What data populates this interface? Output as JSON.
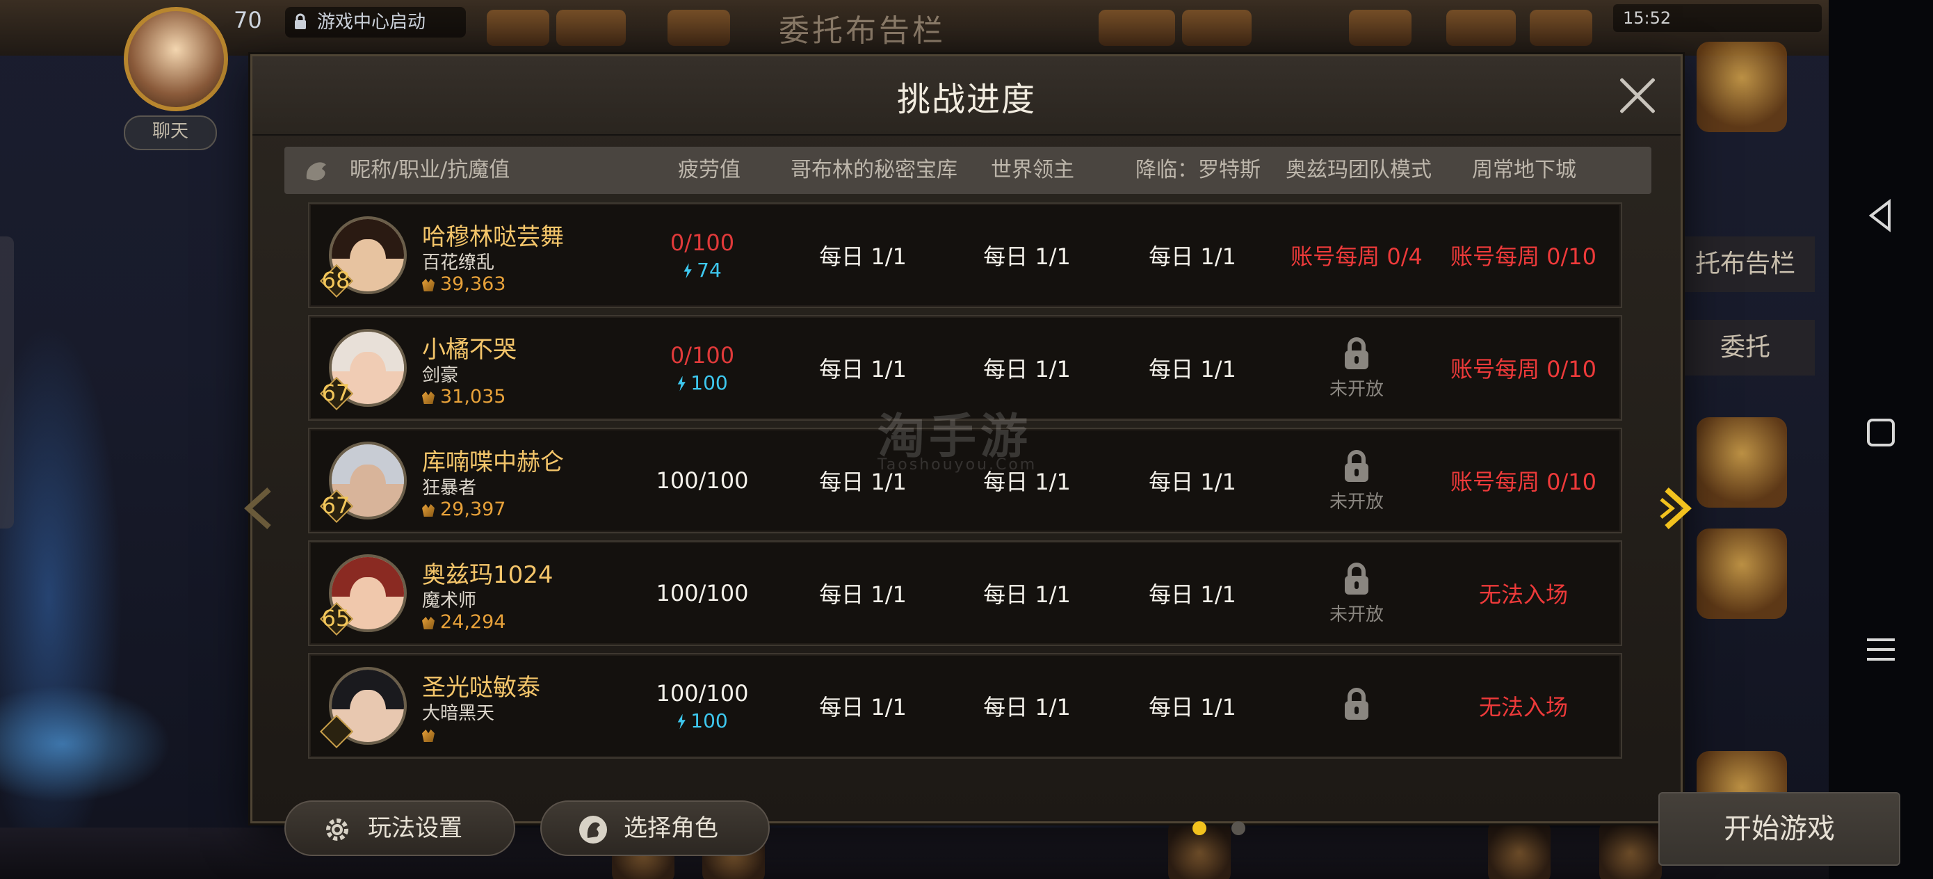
{
  "top_bar": {
    "level": "70",
    "notice": "游戏中心启动",
    "board_title": "委托布告栏",
    "status_time": "15:52"
  },
  "side": {
    "chat_label": "聊天",
    "right_labels": [
      "托布告栏",
      "委托"
    ]
  },
  "dialog": {
    "title": "挑战进度",
    "columns": [
      "昵称/职业/抗魔值",
      "疲劳值",
      "哥布林的秘密宝库",
      "世界领主",
      "降临：罗特斯",
      "奥兹玛团队模式",
      "周常地下城"
    ],
    "rows": [
      {
        "level": "68",
        "name": "哈穆林哒芸舞",
        "job": "百花缭乱",
        "power": "39,363",
        "fatigue": "0/100",
        "fatigue_red": true,
        "energy": "74",
        "goblin": "每日 1/1",
        "lord": "每日 1/1",
        "rotes": "每日 1/1",
        "ozma": "账号每周 0/4",
        "ozma_locked": false,
        "weekly": "账号每周 0/10",
        "hair": "#2a1a12",
        "skin": "#e7c3a0"
      },
      {
        "level": "67",
        "name": "小橘不哭",
        "job": "剑豪",
        "power": "31,035",
        "fatigue": "0/100",
        "fatigue_red": true,
        "energy": "100",
        "goblin": "每日 1/1",
        "lord": "每日 1/1",
        "rotes": "每日 1/1",
        "ozma": "未开放",
        "ozma_locked": true,
        "weekly": "账号每周 0/10",
        "hair": "#e8e0d8",
        "skin": "#f0ccb4"
      },
      {
        "level": "67",
        "name": "库喃喋中赫仑",
        "job": "狂暴者",
        "power": "29,397",
        "fatigue": "100/100",
        "fatigue_red": false,
        "energy": "",
        "goblin": "每日 1/1",
        "lord": "每日 1/1",
        "rotes": "每日 1/1",
        "ozma": "未开放",
        "ozma_locked": true,
        "weekly": "账号每周 0/10",
        "hair": "#c8ccd4",
        "skin": "#d8b49a"
      },
      {
        "level": "65",
        "name": "奥兹玛1024",
        "job": "魔术师",
        "power": "24,294",
        "fatigue": "100/100",
        "fatigue_red": false,
        "energy": "",
        "goblin": "每日 1/1",
        "lord": "每日 1/1",
        "rotes": "每日 1/1",
        "ozma": "未开放",
        "ozma_locked": true,
        "weekly": "无法入场",
        "hair": "#8a2a22",
        "skin": "#f0c8ac"
      },
      {
        "level": "",
        "name": "圣光哒敏泰",
        "job": "大暗黑天",
        "power": "",
        "fatigue": "100/100",
        "fatigue_red": false,
        "energy": "100",
        "goblin": "每日 1/1",
        "lord": "每日 1/1",
        "rotes": "每日 1/1",
        "ozma": "",
        "ozma_locked": true,
        "weekly": "无法入场",
        "hair": "#1a1a1e",
        "skin": "#e8c8b0"
      }
    ],
    "footer": {
      "settings_label": "玩法设置",
      "select_label": "选择角色",
      "start_label": "开始游戏",
      "page_current": 1,
      "page_total": 2
    }
  },
  "watermark": {
    "main": "淘手游",
    "sub": "Taoshouyou.Com"
  },
  "colors": {
    "accent_gold": "#f4c56a",
    "warn_red": "#ee3a3a",
    "energy_cyan": "#3ec8ef",
    "dot_active": "#f2c21e",
    "dot_inactive": "#5a5650"
  }
}
